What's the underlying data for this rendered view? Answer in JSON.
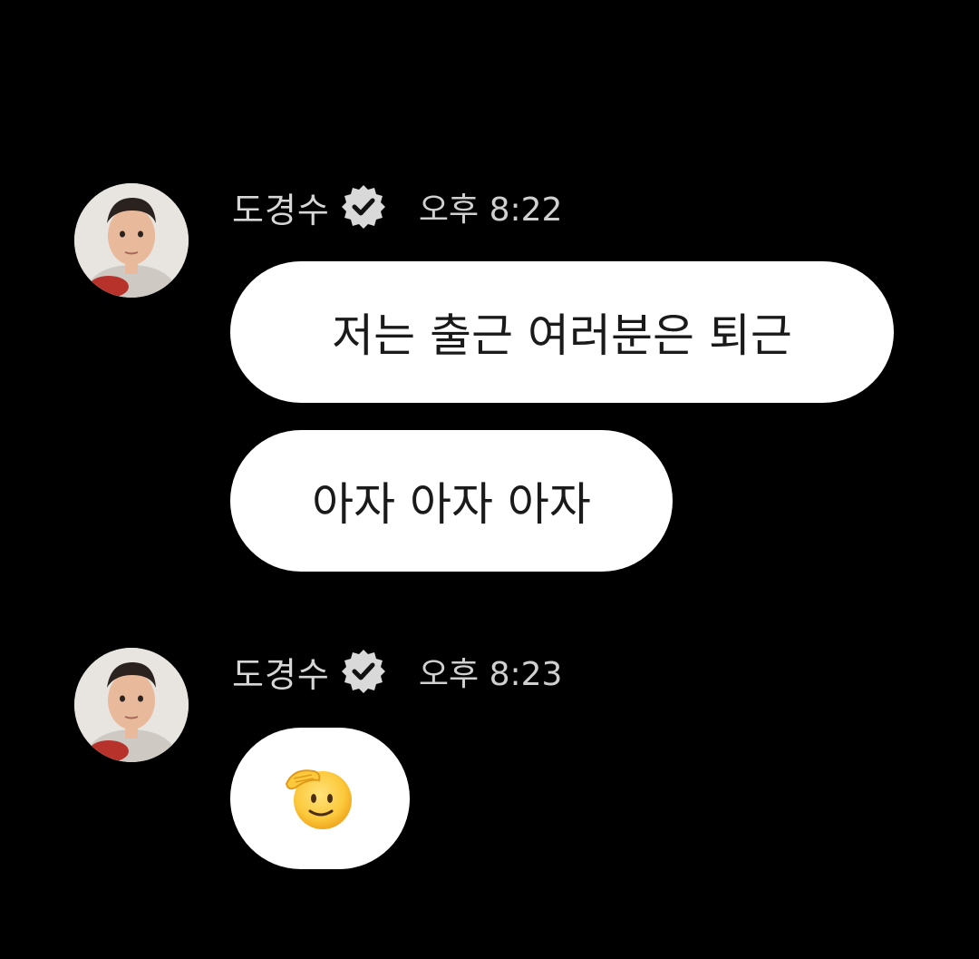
{
  "messages": [
    {
      "sender": "도경수",
      "time": "오후 8:22",
      "bubbles": [
        "저는 출근 여러분은 퇴근",
        "아자 아자 아자"
      ]
    },
    {
      "sender": "도경수",
      "time": "오후 8:23",
      "emoji": "saluting-face-emoji"
    }
  ],
  "icons": {
    "verified": "verified-badge-icon",
    "avatar": "profile-avatar"
  },
  "colors": {
    "background": "#000000",
    "bubble": "#FFFFFF",
    "bubble_text": "#1A1A1A",
    "meta_text": "#D4D4D4"
  }
}
